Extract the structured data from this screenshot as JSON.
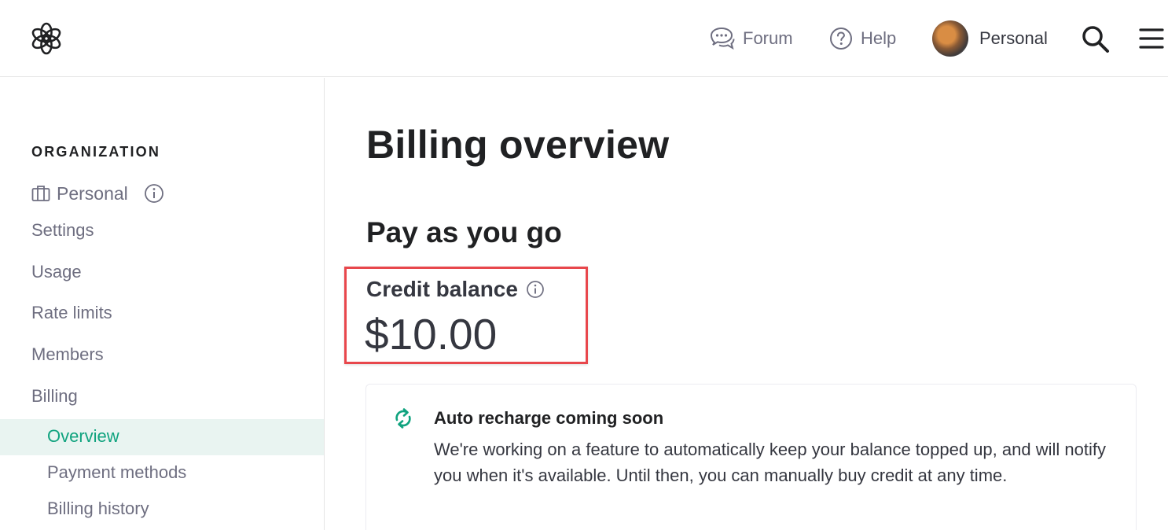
{
  "header": {
    "forum_label": "Forum",
    "help_label": "Help",
    "account_label": "Personal"
  },
  "sidebar": {
    "org_heading": "ORGANIZATION",
    "org_name": "Personal",
    "items": [
      "Settings",
      "Usage",
      "Rate limits",
      "Members",
      "Billing"
    ],
    "billing_sub": [
      "Overview",
      "Payment methods",
      "Billing history"
    ],
    "active_sub": "Overview"
  },
  "main": {
    "title": "Billing overview",
    "section_title": "Pay as you go",
    "credit_label": "Credit balance",
    "credit_value": "$10.00",
    "notice": {
      "title": "Auto recharge coming soon",
      "body": "We're working on a feature to automatically keep your balance topped up, and will notify you when it's available. Until then, you can manually buy credit at any time."
    }
  },
  "colors": {
    "accent": "#10a37f",
    "active_bg": "#e9f4f1",
    "highlight_border": "#e8474c",
    "muted_text": "#6e6e80"
  },
  "icons": [
    "openai-logo-icon",
    "forum-icon",
    "help-icon",
    "avatar",
    "search-icon",
    "menu-icon",
    "briefcase-icon",
    "info-icon",
    "refresh-icon"
  ]
}
